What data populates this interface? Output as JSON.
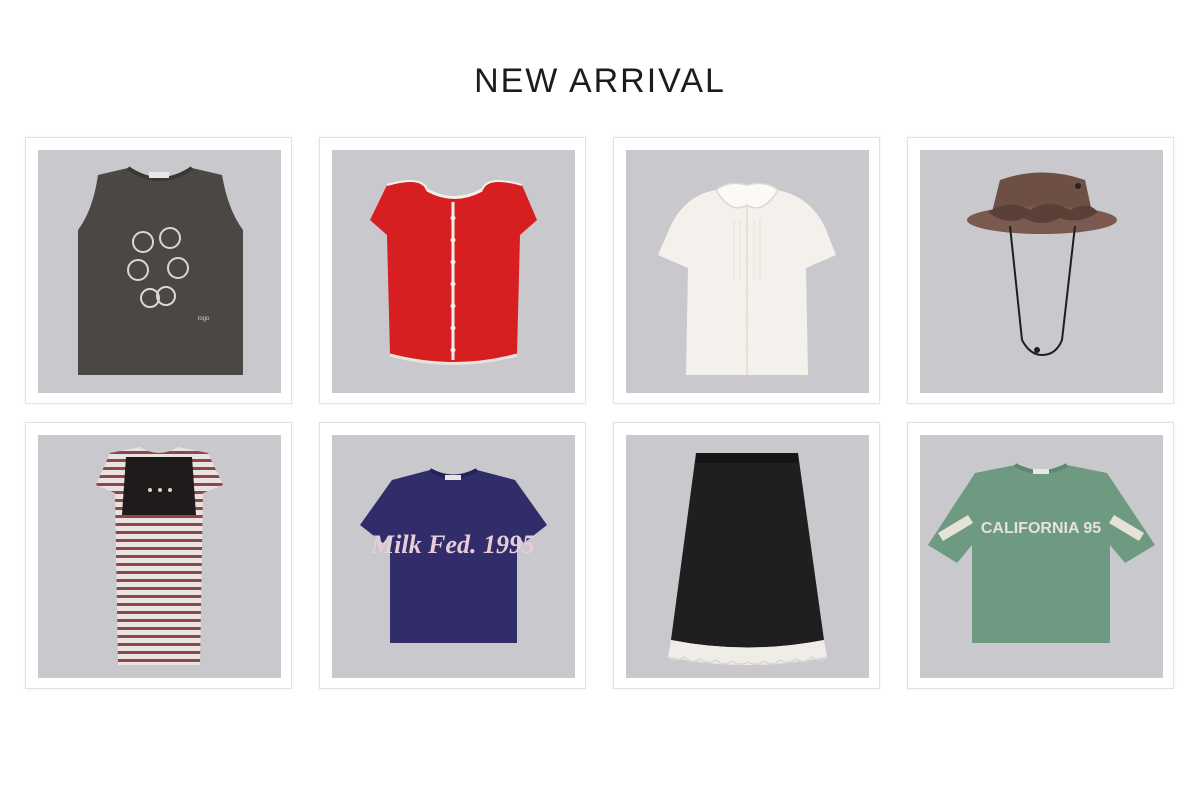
{
  "page": {
    "title": "NEW ARRIVAL"
  },
  "products": [
    {
      "id": 1,
      "name": "washed-skull-print-tank",
      "text": ""
    },
    {
      "id": 2,
      "name": "red-piped-cap-sleeve-top",
      "text": ""
    },
    {
      "id": 3,
      "name": "white-frill-collar-blouse",
      "text": ""
    },
    {
      "id": 4,
      "name": "brown-ruffle-bucket-hat",
      "text": ""
    },
    {
      "id": 5,
      "name": "striped-vest-layered-dress",
      "text": ""
    },
    {
      "id": 6,
      "name": "navy-milk-fed-logo-tee",
      "text": "Milk Fed. 1995"
    },
    {
      "id": 7,
      "name": "black-lace-hem-skirt",
      "text": ""
    },
    {
      "id": 8,
      "name": "green-california-95-tee",
      "text": "CALIFORNIA 95"
    }
  ],
  "colors": {
    "photo_bg": "#c9c9cd",
    "card_border": "#e2e2e2",
    "title": "#1c1c1c"
  }
}
